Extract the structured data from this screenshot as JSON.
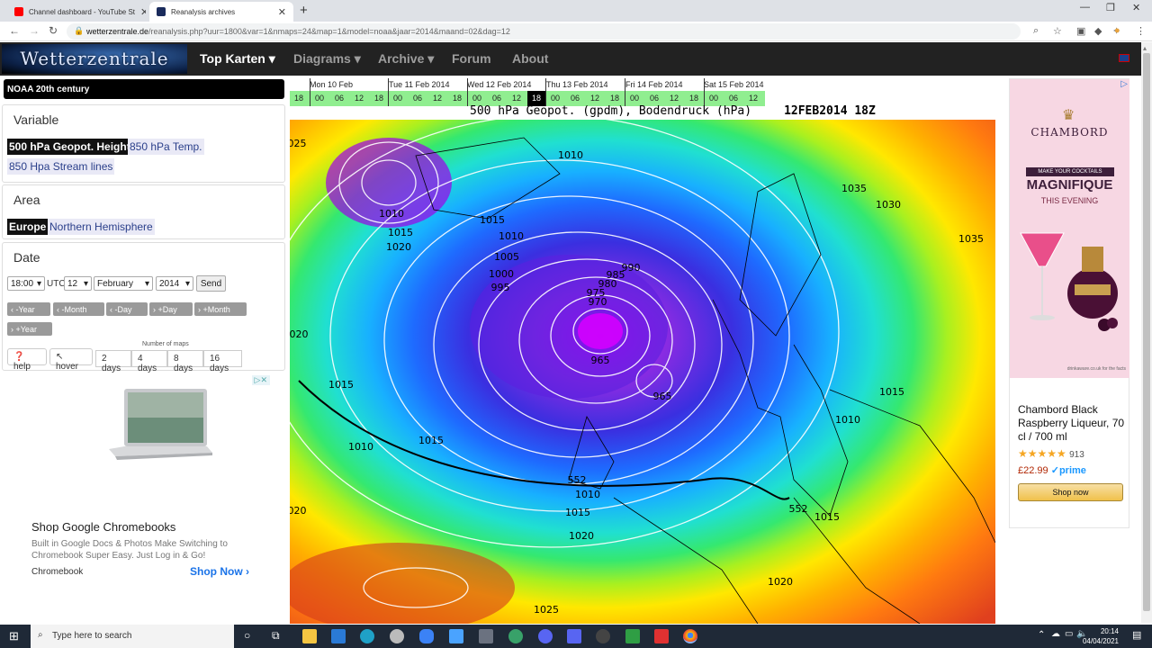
{
  "browser": {
    "tabs": [
      {
        "label": "Channel dashboard - YouTube St"
      },
      {
        "label": "Reanalysis archives"
      }
    ],
    "url_host": "wetterzentrale.de",
    "url_rest": "/reanalysis.php?uur=1800&var=1&nmaps=24&map=1&model=noaa&jaar=2014&maand=02&dag=12"
  },
  "site": {
    "logo": "Wetterzentrale",
    "menu": [
      "Top Karten",
      "Diagrams",
      "Archive",
      "Forum",
      "About"
    ]
  },
  "sidebar": {
    "dataset": "NOAA 20th century",
    "variable_title": "Variable",
    "variables": [
      "500 hPa Geopot. Height",
      "850 hPa Temp.",
      "850 Hpa Stream lines"
    ],
    "area_title": "Area",
    "areas": [
      "Europe",
      "Northern Hemisphere"
    ],
    "date_title": "Date",
    "hour": "18:00",
    "utc": "UTC",
    "day": "12",
    "month": "February",
    "year": "2014",
    "send": "Send",
    "nav_buttons": [
      "-Year",
      "-Month",
      "-Day",
      "+Day",
      "+Month",
      "+Year"
    ],
    "help": "help",
    "hover": "hover",
    "num_maps_label": "Number of maps",
    "num_maps": [
      "2 days",
      "4 days",
      "8 days",
      "16 days"
    ]
  },
  "left_ad": {
    "title": "Shop Google Chromebooks",
    "desc": "Built in Google Docs & Photos Make Switching to Chromebook Super Easy. Just Log in & Go!",
    "brand": "Chromebook",
    "cta": "Shop Now"
  },
  "timeline": {
    "days": [
      "Mon 10 Feb",
      "Tue 11 Feb 2014",
      "Wed 12 Feb 2014",
      "Thu 13 Feb 2014",
      "Fri 14 Feb 2014",
      "Sat 15 Feb 2014"
    ],
    "hours": [
      "18",
      "00",
      "06",
      "12",
      "18",
      "00",
      "06",
      "12",
      "18",
      "00",
      "06",
      "12",
      "18",
      "00",
      "06",
      "12",
      "18",
      "00",
      "06",
      "12",
      "18",
      "00",
      "06",
      "12"
    ],
    "current_hour_index": 12
  },
  "map": {
    "title": "500 hPa Geopot. (gpdm), Bodendruck (hPa)",
    "stamp": "12FEB2014 18Z",
    "isobars": [
      "1010",
      "1035",
      "1030",
      "1015",
      "1010",
      "1010",
      "1020",
      "1015",
      "1005",
      "1000",
      "995",
      "990",
      "985",
      "980",
      "975",
      "970",
      "965",
      "965",
      "1035",
      "1030",
      "1015",
      "1010",
      "1015",
      "1010",
      "1015",
      "552",
      "1010",
      "1015",
      "1020",
      "552",
      "1015",
      "1020",
      "1025",
      "020",
      "025",
      "030"
    ]
  },
  "right_ad": {
    "brand": "CHAMBORD",
    "tag": "MAKE YOUR COCKTAILS",
    "headline": "MAGNIFIQUE",
    "sub": "THIS EVENING",
    "site": "drinkaware.co.uk for the facts",
    "product": "Chambord Black Raspberry Liqueur, 70 cl / 700 ml",
    "reviews": "913",
    "price": "£22.99",
    "prime": "prime",
    "cta": "Shop now"
  },
  "taskbar": {
    "search": "Type here to search",
    "time": "20:14",
    "date": "04/04/2021"
  }
}
